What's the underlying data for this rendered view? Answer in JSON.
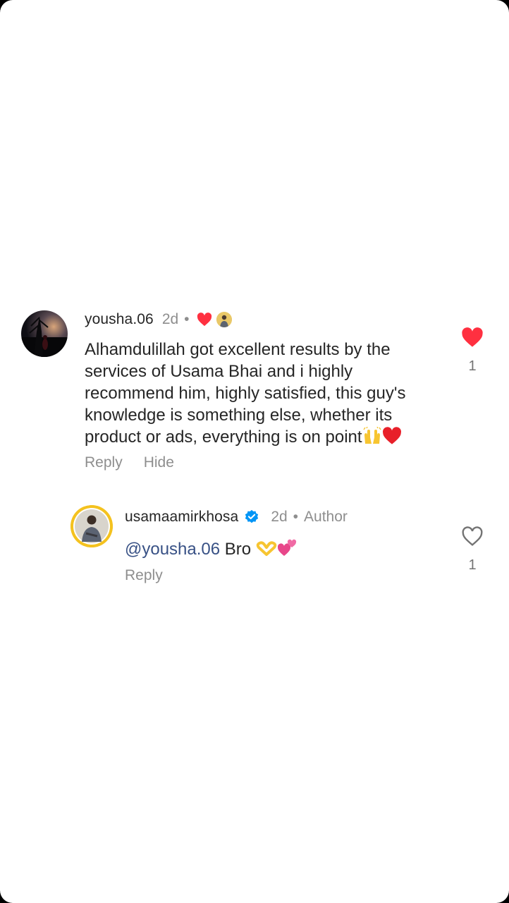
{
  "comments": [
    {
      "username": "yousha.06",
      "time": "2d",
      "text": "Alhamdulillah got excellent results by the services of Usama Bhai and i highly recommend him, highly satisfied, this guy's knowledge is something else, whether its product or ads, everything is on point",
      "actions": [
        "Reply",
        "Hide"
      ],
      "like_count": "1",
      "liked": true,
      "liked_by_author": true
    },
    {
      "username": "usamaamirkhosa",
      "time": "2d",
      "author_label": "Author",
      "mention": "@yousha.06",
      "text": " Bro ",
      "actions": [
        "Reply"
      ],
      "like_count": "1",
      "liked": false,
      "verified": true
    }
  ],
  "colors": {
    "heart_red": "#ff3040",
    "verified_blue": "#0095f6",
    "mention_blue": "#385185",
    "muted_gray": "#8e8e8e"
  },
  "icons": {
    "like_filled": "heart-filled-icon",
    "like_outline": "heart-outline-icon",
    "verified": "verified-badge-icon",
    "emoji_hands": "raised-hands-emoji",
    "emoji_heart": "red-heart-emoji",
    "emoji_heart_hands": "heart-hands-emoji",
    "emoji_two_hearts": "two-hearts-emoji"
  }
}
